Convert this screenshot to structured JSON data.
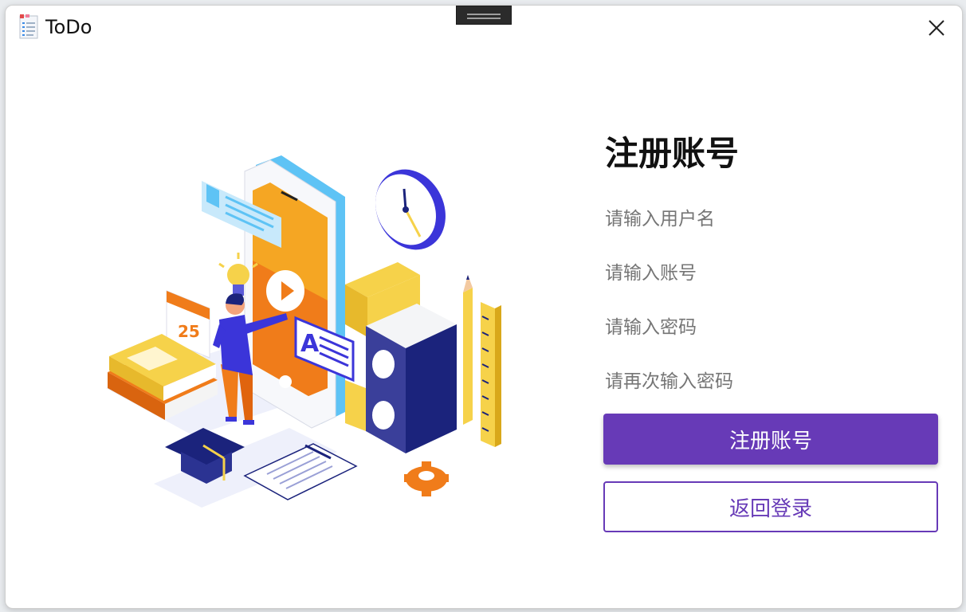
{
  "window": {
    "title": "ToDo"
  },
  "register": {
    "heading": "注册账号",
    "username_placeholder": "请输入用户名",
    "account_placeholder": "请输入账号",
    "password_placeholder": "请输入密码",
    "confirm_password_placeholder": "请再次输入密码",
    "register_button_label": "注册账号",
    "back_button_label": "返回登录"
  },
  "illustration": {
    "calendar_day": "25",
    "card_letter": "A"
  },
  "colors": {
    "accent": "#673ab7",
    "orange": "#f07c1a",
    "yellow": "#f6d24a",
    "navy": "#1b237c",
    "blue": "#3b35d9"
  }
}
